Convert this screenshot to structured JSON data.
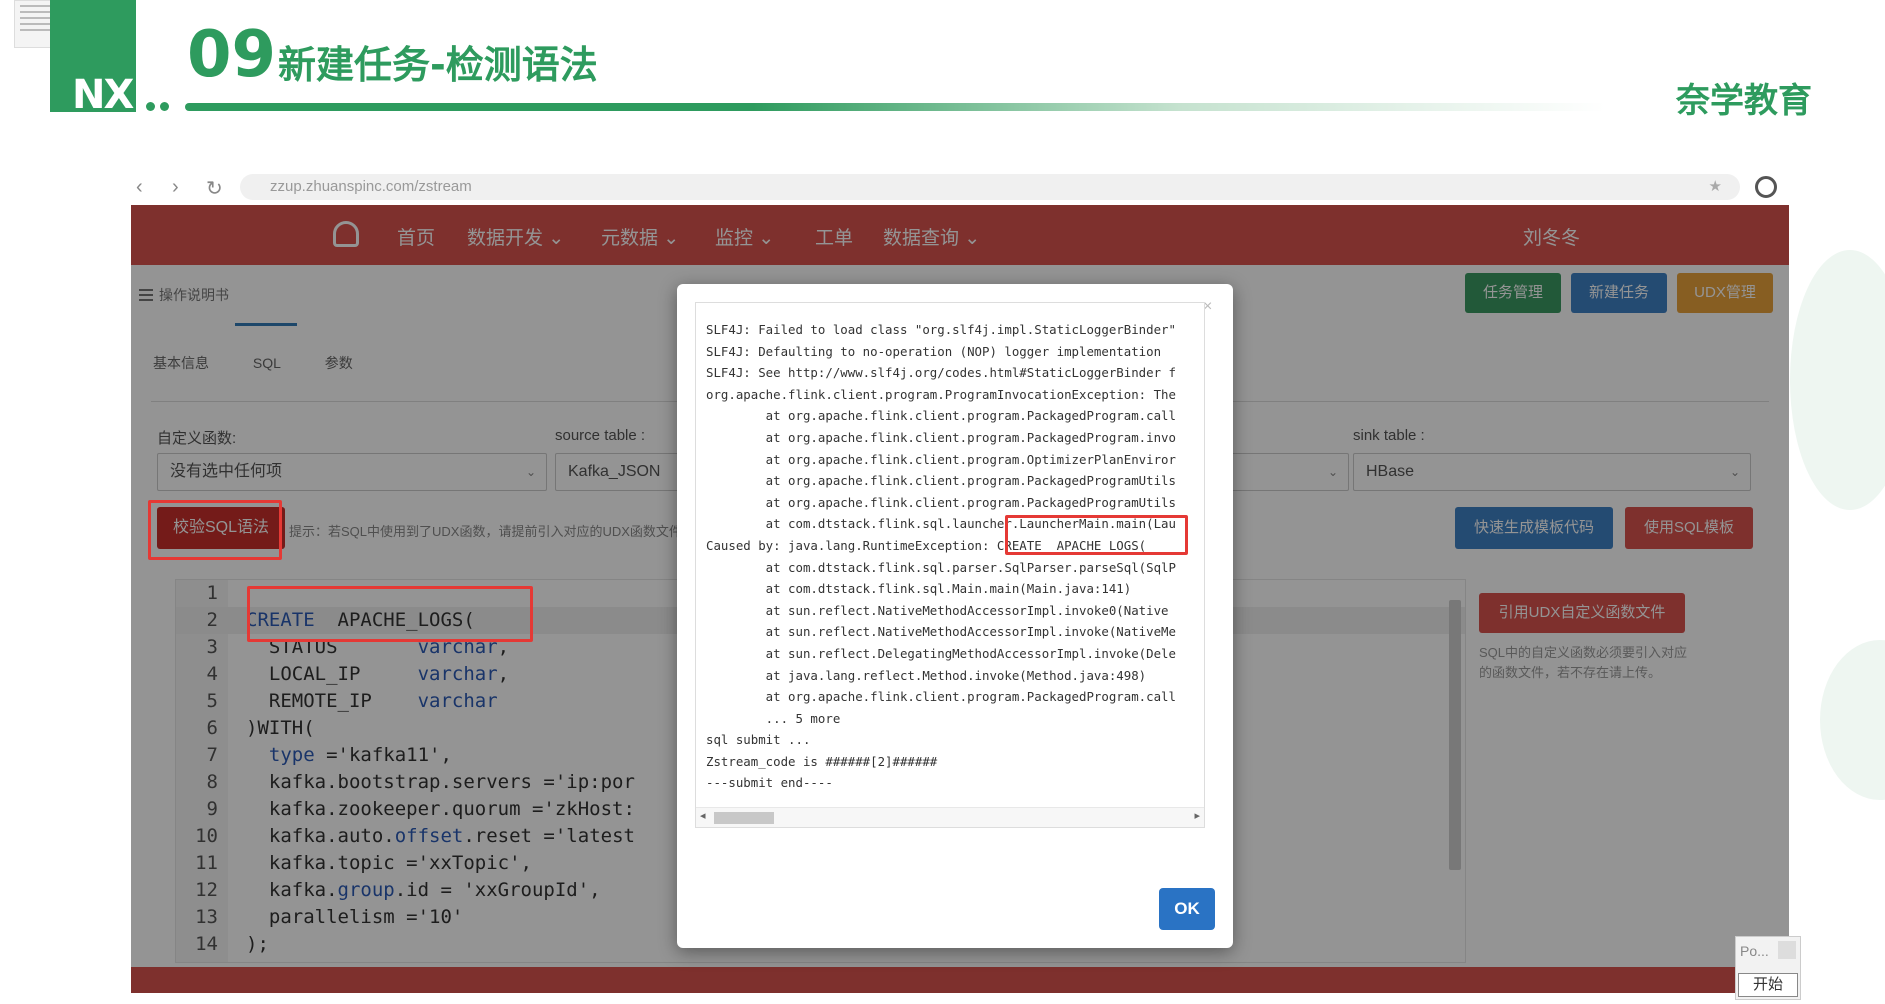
{
  "slide": {
    "number": "09",
    "title": "新建任务-检测语法",
    "logo_text": "NX",
    "brand": "奈学教育"
  },
  "browser": {
    "back_glyph": "‹",
    "forward_glyph": "›",
    "reload_glyph": "↻",
    "url": "zzup.zhuanspinc.com/zstream"
  },
  "app": {
    "nav": {
      "items": [
        "首页",
        "数据开发 ⌄",
        "元数据 ⌄",
        "监控 ⌄",
        "工单",
        "数据查询 ⌄"
      ],
      "user": "刘冬冬"
    },
    "breadcrumb": "操作说明书",
    "buttons": {
      "task_manage": "任务管理",
      "new_task": "新建任务",
      "udx_manage": "UDX管理",
      "validate_sql": "校验SQL语法",
      "quick_generate": "快速生成模板代码",
      "use_sql_template": "使用SQL模板",
      "import_udx": "引用UDX自定义函数文件"
    },
    "tabs": [
      "基本信息",
      "SQL",
      "参数"
    ],
    "fields": {
      "udf_label": "自定义函数:",
      "udf_value": "没有选中任何项",
      "source_label": "source table :",
      "source_value": "Kafka_JSON",
      "sink_label": "sink table :",
      "sink_value": "HBase"
    },
    "hint": "提示：若SQL中使用到了UDX函数，请提前引入对应的UDX函数文件",
    "side_note": "SQL中的自定义函数必须要引入对应的函数文件，若不存在请上传。",
    "code_lines": [
      {
        "n": "1",
        "pre": "",
        "kw": "",
        "rest": ""
      },
      {
        "n": "2",
        "pre": "",
        "kw": "CREATE",
        "rest": "  APACHE_LOGS("
      },
      {
        "n": "3",
        "pre": "  STATUS       ",
        "kw": "varchar",
        "rest": ","
      },
      {
        "n": "4",
        "pre": "  LOCAL_IP     ",
        "kw": "varchar",
        "rest": ","
      },
      {
        "n": "5",
        "pre": "  REMOTE_IP    ",
        "kw": "varchar",
        "rest": ""
      },
      {
        "n": "6",
        "pre": ")WITH(",
        "kw": "",
        "rest": ""
      },
      {
        "n": "7",
        "pre": "  ",
        "kw": "type",
        "rest": " ='kafka11',"
      },
      {
        "n": "8",
        "pre": "  kafka.bootstrap.servers ='ip:por",
        "kw": "",
        "rest": ""
      },
      {
        "n": "9",
        "pre": "  kafka.zookeeper.quorum ='zkHost:",
        "kw": "",
        "rest": ""
      },
      {
        "n": "10",
        "pre": "  kafka.auto.",
        "kw": "offset",
        "rest": ".reset ='latest"
      },
      {
        "n": "11",
        "pre": "  kafka.topic ='xxTopic',",
        "kw": "",
        "rest": ""
      },
      {
        "n": "12",
        "pre": "  kafka.",
        "kw": "group",
        "rest": ".id = 'xxGroupId',"
      },
      {
        "n": "13",
        "pre": "  parallelism ='10'",
        "kw": "",
        "rest": ""
      },
      {
        "n": "14",
        "pre": ");",
        "kw": "",
        "rest": ""
      }
    ]
  },
  "modal": {
    "close": "×",
    "ok": "OK",
    "log_lines": [
      "SLF4J: Failed to load class \"org.slf4j.impl.StaticLoggerBinder\"",
      "SLF4J: Defaulting to no-operation (NOP) logger implementation",
      "SLF4J: See http://www.slf4j.org/codes.html#StaticLoggerBinder f",
      "org.apache.flink.client.program.ProgramInvocationException: The",
      "        at org.apache.flink.client.program.PackagedProgram.call",
      "        at org.apache.flink.client.program.PackagedProgram.invo",
      "        at org.apache.flink.client.program.OptimizerPlanEnviror",
      "        at org.apache.flink.client.program.PackagedProgramUtils",
      "        at org.apache.flink.client.program.PackagedProgramUtils",
      "        at com.dtstack.flink.sql.launcher.LauncherMain.main(Lau",
      "Caused by: java.lang.RuntimeException: CREATE  APACHE_LOGS(",
      "        at com.dtstack.flink.sql.parser.SqlParser.parseSql(SqlP",
      "        at com.dtstack.flink.sql.Main.main(Main.java:141)",
      "        at sun.reflect.NativeMethodAccessorImpl.invoke0(Native",
      "        at sun.reflect.NativeMethodAccessorImpl.invoke(NativeMe",
      "        at sun.reflect.DelegatingMethodAccessorImpl.invoke(Dele",
      "        at java.lang.reflect.Method.invoke(Method.java:498)",
      "        at org.apache.flink.client.program.PackagedProgram.call",
      "        ... 5 more",
      "sql submit ...",
      "Zstream_code is ######[2]######",
      "---submit end----"
    ]
  },
  "widget": {
    "po": "Po...",
    "start": "开始"
  },
  "colors": {
    "brand_green": "#2e9b5e",
    "nav_red": "#d9534f",
    "annotation_red": "#e53935",
    "ok_blue": "#2a73c4"
  }
}
